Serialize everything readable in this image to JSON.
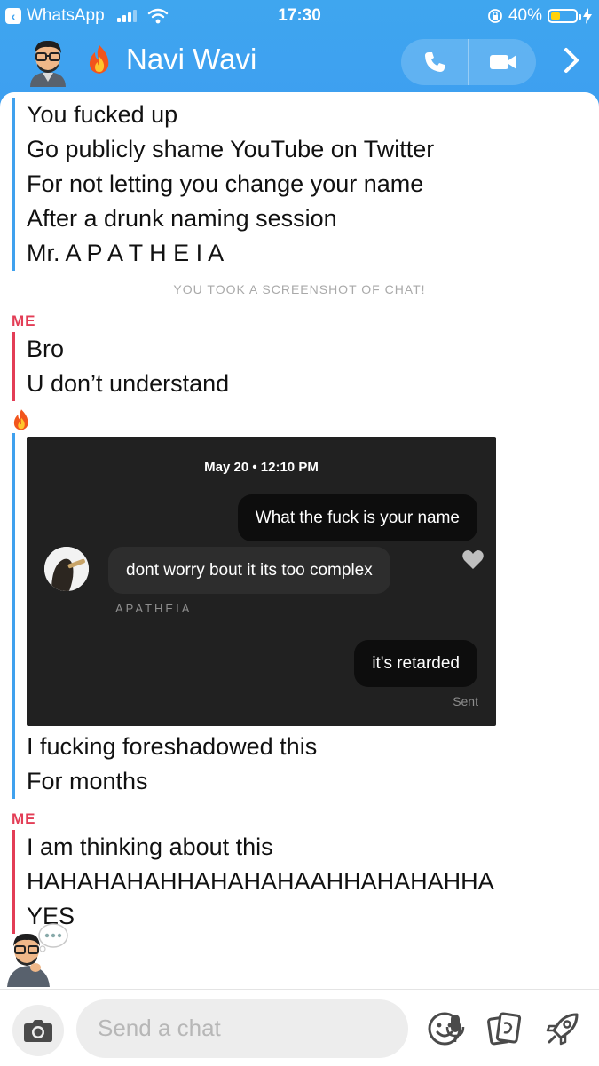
{
  "status_bar": {
    "back_app": "WhatsApp",
    "time": "17:30",
    "battery": "40%",
    "battery_level": 0.4
  },
  "header": {
    "contact_name": "Navi Wavi",
    "contact_emoji": "fire-icon",
    "buttons": [
      "phone-icon",
      "video-icon",
      "chevron-right-icon"
    ]
  },
  "messages": {
    "block1": [
      "You fucked up",
      "Go publicly shame YouTube on Twitter",
      "For not letting you change your name",
      "After a drunk naming session",
      "Mr. A P A T H E I A"
    ],
    "system_notice": "YOU TOOK A SCREENSHOT OF CHAT!",
    "sender_me": "ME",
    "block2": [
      "Bro",
      "U don’t understand"
    ],
    "block3_after_image": [
      "I fucking foreshadowed this",
      "For months"
    ],
    "block4": [
      "I am thinking about this",
      "HAHAHAHAHHAHAHAHAAHHAHAHAHHA",
      "YES"
    ]
  },
  "shared_screenshot": {
    "date": "May 20 • 12:10 PM",
    "outgoing_1": "What the fuck is your name",
    "incoming_1": "dont worry bout it its too complex",
    "username": "APATHEIA",
    "outgoing_2": "it's retarded",
    "status": "Sent"
  },
  "composer": {
    "placeholder": "Send a chat",
    "icons": [
      "camera-icon",
      "microphone-icon",
      "smiley-icon",
      "sticker-icon",
      "rocket-icon"
    ]
  },
  "colors": {
    "header_blue": "#3fa1ee",
    "friend_bar": "#3fa1ee",
    "me_red": "#e33d56"
  }
}
